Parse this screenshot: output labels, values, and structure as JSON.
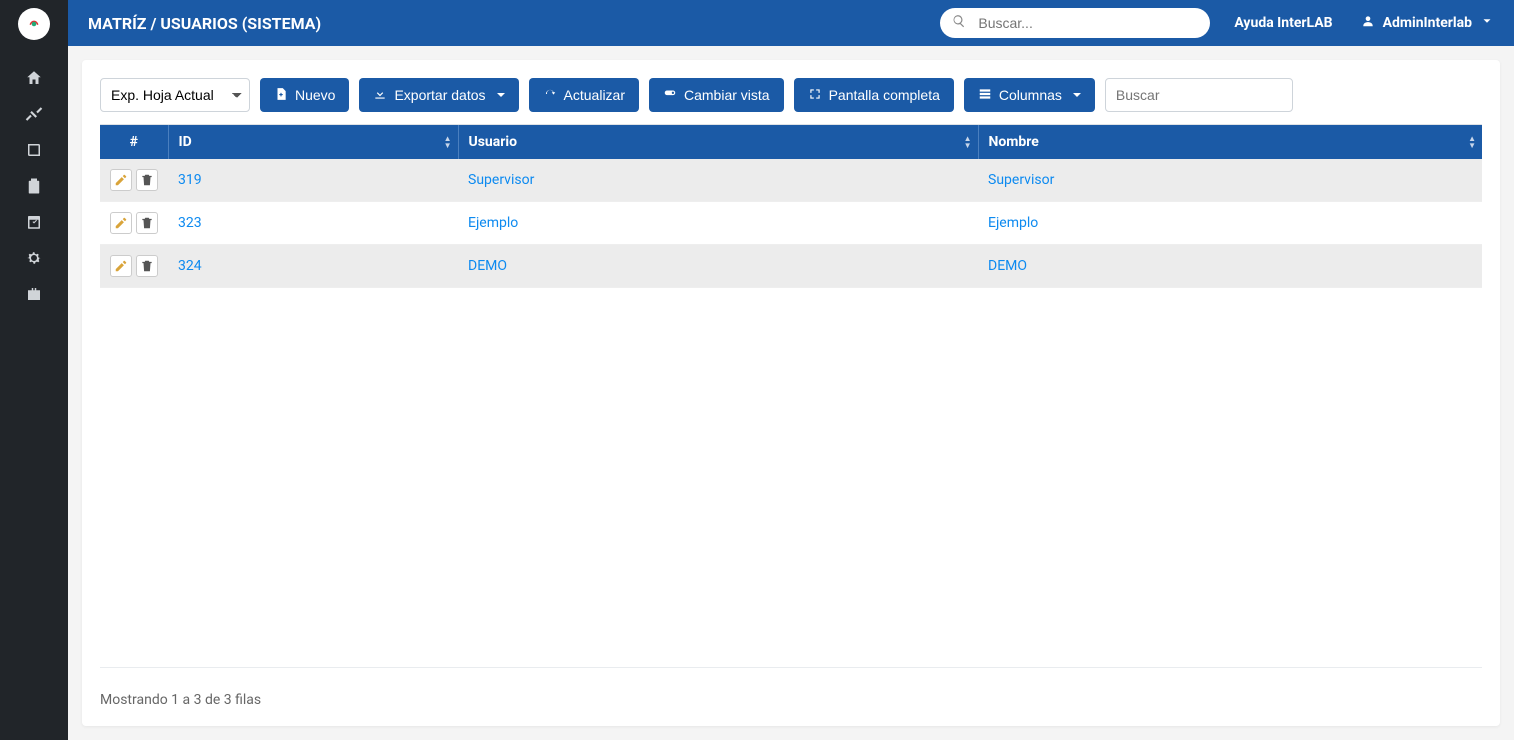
{
  "header": {
    "title": "MATRÍZ / USUARIOS (SISTEMA)",
    "search_placeholder": "Buscar...",
    "help_label": "Ayuda InterLAB",
    "user_name": "AdminInterlab"
  },
  "toolbar": {
    "export_select": "Exp. Hoja Actual",
    "new_label": "Nuevo",
    "export_label": "Exportar datos",
    "refresh_label": "Actualizar",
    "toggle_view_label": "Cambiar vista",
    "fullscreen_label": "Pantalla completa",
    "columns_label": "Columnas",
    "table_search_placeholder": "Buscar"
  },
  "table": {
    "columns": {
      "actions": "#",
      "id": "ID",
      "user": "Usuario",
      "name": "Nombre"
    },
    "rows": [
      {
        "id": "319",
        "user": "Supervisor",
        "name": "Supervisor"
      },
      {
        "id": "323",
        "user": "Ejemplo",
        "name": "Ejemplo"
      },
      {
        "id": "324",
        "user": "DEMO",
        "name": "DEMO"
      }
    ]
  },
  "footer": {
    "summary": "Mostrando 1 a 3 de 3 filas"
  }
}
